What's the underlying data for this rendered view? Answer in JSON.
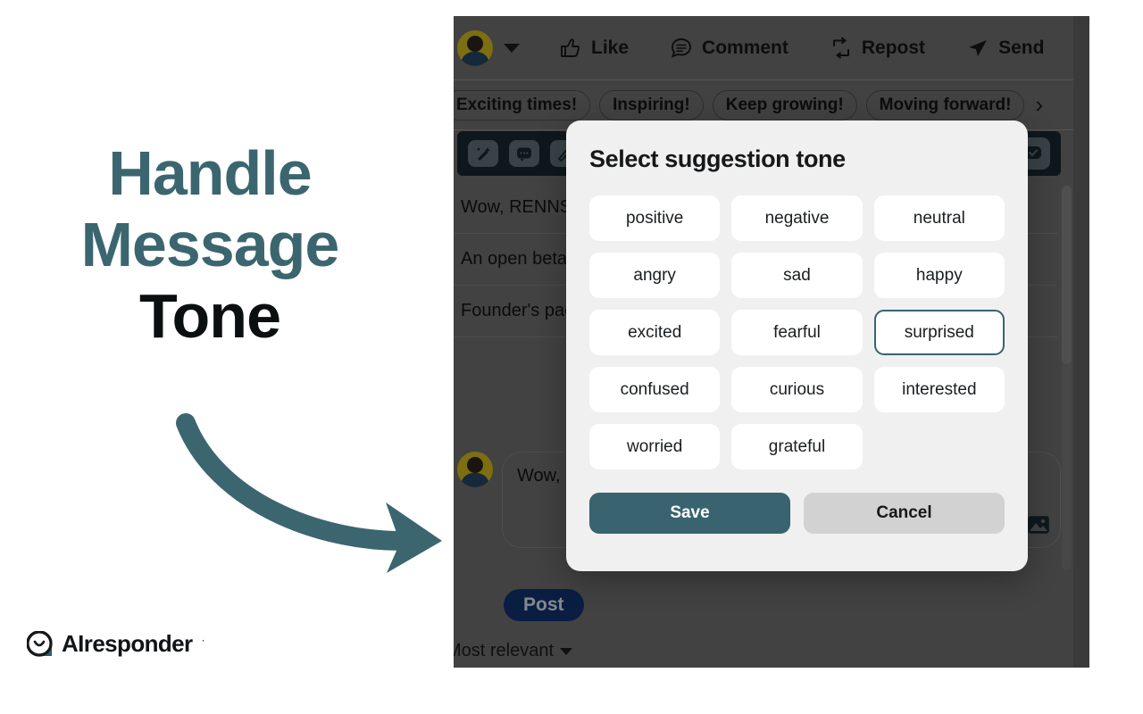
{
  "promo": {
    "title_line1": "Handle",
    "title_line2": "Message",
    "title_line3": "Tone",
    "accent_color": "#3b6670",
    "dark_color": "#0c0f10",
    "arrow_icon": "curved-arrow-right-icon"
  },
  "brand": {
    "name": "AIresponder",
    "trademark": "·",
    "logo_icon": "smiley-chat-bubble-icon"
  },
  "screenshot": {
    "action_bar": {
      "avatar_icon": "user-avatar",
      "caret_icon": "chevron-down-icon",
      "actions": [
        {
          "label": "Like",
          "icon": "thumbs-up-icon"
        },
        {
          "label": "Comment",
          "icon": "comment-bubble-icon"
        },
        {
          "label": "Repost",
          "icon": "repost-arrows-icon"
        },
        {
          "label": "Send",
          "icon": "send-paper-plane-icon"
        }
      ]
    },
    "chips": {
      "items": [
        "Exciting times!",
        "Inspiring!",
        "Keep growing!",
        "Moving forward!"
      ],
      "next_icon": "chevron-right-icon"
    },
    "ai_toolbar": {
      "left_icons": [
        "magic-wand-icon",
        "chat-bubble-icon",
        "pencil-settings-icon"
      ],
      "right_icon": "ai-check-bubble-icon",
      "background": "#17282e"
    },
    "suggestions": [
      "Wow, RENNSPORT is changing the game in this racing world!",
      "An open beta for sim racing — exciting news for racing fans!",
      "Founder's pack owners are really stepping up the racing experience!"
    ],
    "composer": {
      "text": "Wow, RENNSPORT is changing the game in this racing world!",
      "image_icon": "image-upload-icon",
      "avatar_icon": "user-avatar"
    },
    "post_button": "Post",
    "sort": {
      "label": "Most relevant",
      "caret_icon": "chevron-down-icon"
    },
    "scrollbar_icon": "vertical-scrollbar"
  },
  "modal": {
    "title": "Select suggestion tone",
    "tones": [
      "positive",
      "negative",
      "neutral",
      "angry",
      "sad",
      "happy",
      "excited",
      "fearful",
      "surprised",
      "confused",
      "curious",
      "interested",
      "worried",
      "grateful"
    ],
    "selected_tone": "surprised",
    "selected_border_color": "#356471",
    "save_label": "Save",
    "cancel_label": "Cancel",
    "save_color": "#38636f",
    "cancel_color": "#d2d2d2"
  }
}
